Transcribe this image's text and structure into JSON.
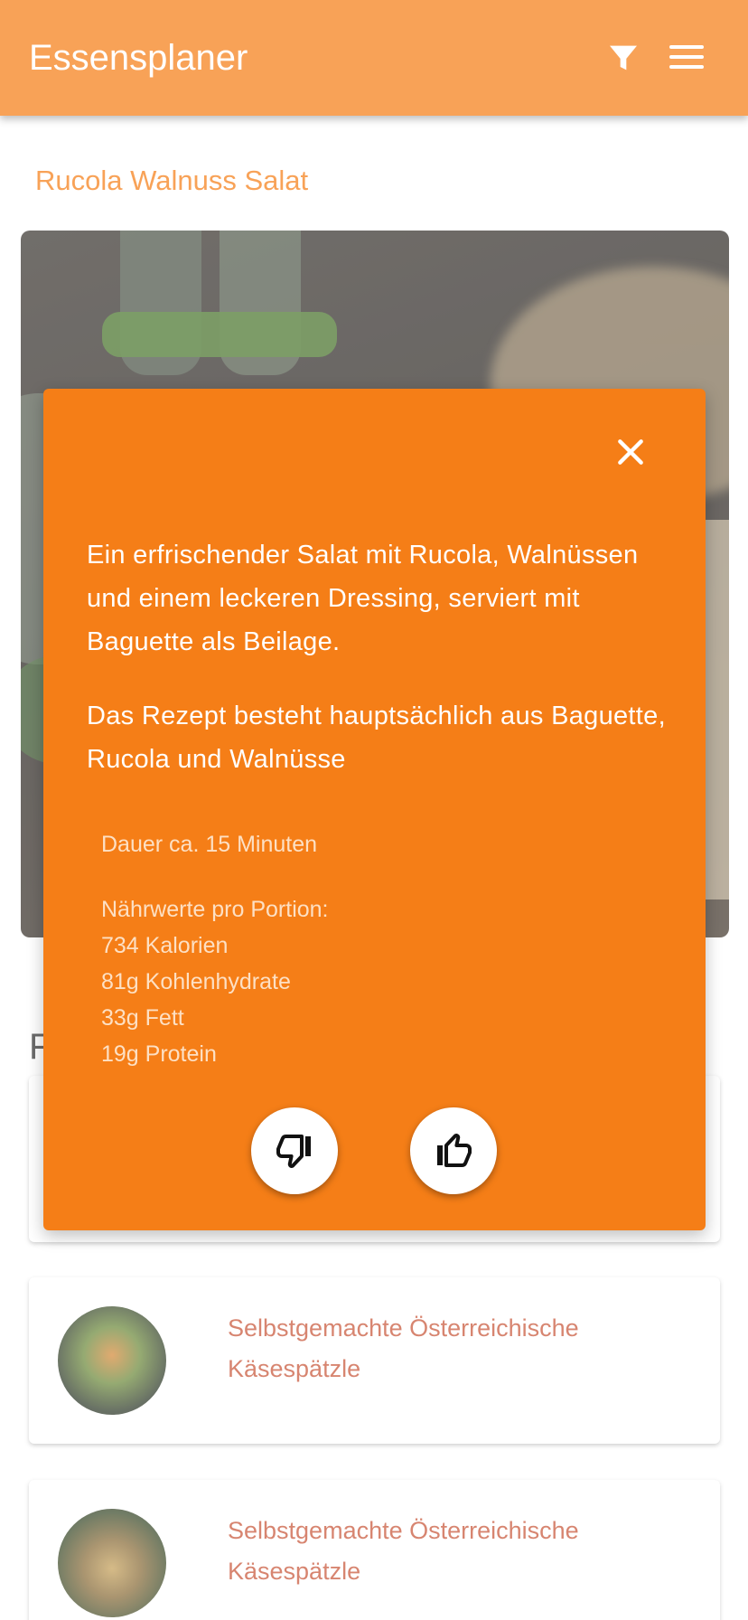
{
  "app": {
    "title": "Essensplaner"
  },
  "recipe": {
    "title": "Rucola Walnuss Salat"
  },
  "section": {
    "heading_partial": "F"
  },
  "modal": {
    "description": "Ein erfrischender Salat mit Rucola, Walnüssen und einem leckeren Dressing, serviert mit Baguette als Beilage.",
    "ingredients": "Das Rezept besteht hauptsächlich aus Baguette, Rucola und Walnüsse",
    "duration": "Dauer ca. 15 Minuten",
    "nutrition_heading": "Nährwerte pro Portion:",
    "nutrition": [
      "734 Kalorien",
      "81g Kohlenhydrate",
      "33g Fett",
      "19g Protein"
    ]
  },
  "list": [
    {
      "title": "Selbstgemachte Österreichische Käsespätzle"
    },
    {
      "title": "Selbstgemachte Österreichische Käsespätzle"
    }
  ],
  "colors": {
    "primary": "#f57e17",
    "card_text": "#c8563a"
  },
  "icons": [
    "filter-icon",
    "menu-icon",
    "close-icon",
    "thumbs-down-icon",
    "thumbs-up-icon"
  ]
}
